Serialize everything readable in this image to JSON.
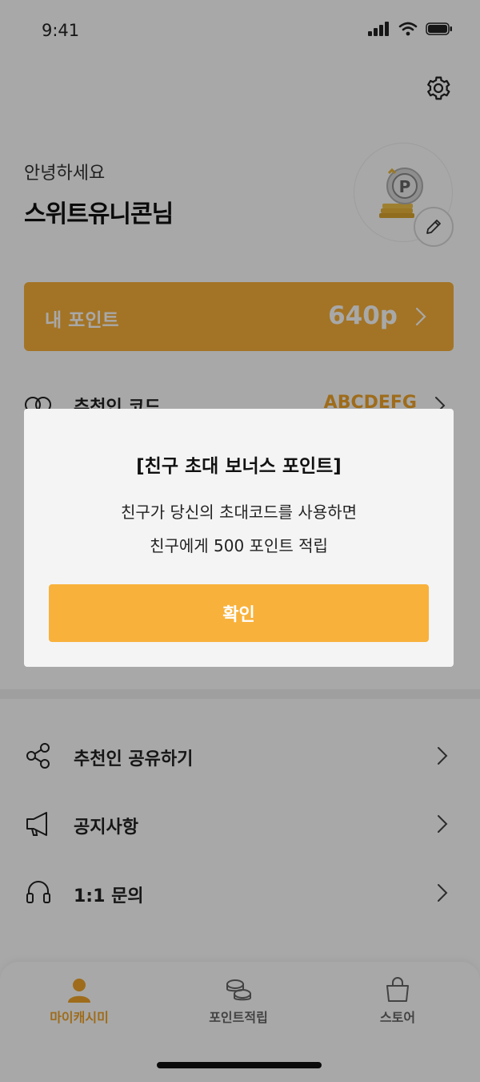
{
  "status": {
    "time": "9:41"
  },
  "header": {
    "settings_icon": "gear-icon"
  },
  "profile": {
    "greeting": "안녕하세요",
    "username": "스위트유니콘님",
    "avatar_icon": "coin-stack-icon",
    "edit_icon": "pencil-icon"
  },
  "points": {
    "label": "내 포인트",
    "value": "640p"
  },
  "referral": {
    "label": "추천인 코드",
    "code": "ABCDEFG"
  },
  "menu": {
    "items": [
      {
        "label": "추천인 공유하기",
        "icon": "share-icon"
      },
      {
        "label": "공지사항",
        "icon": "megaphone-icon"
      },
      {
        "label": "1:1 문의",
        "icon": "headset-icon"
      }
    ]
  },
  "tabs": [
    {
      "label": "마이캐시미",
      "icon": "person-icon",
      "active": true
    },
    {
      "label": "포인트적립",
      "icon": "coins-icon",
      "active": false
    },
    {
      "label": "스토어",
      "icon": "shopping-bag-icon",
      "active": false
    }
  ],
  "dialog": {
    "title": "[친구 초대 보너스 포인트]",
    "line1": "친구가 당신의 초대코드를 사용하면",
    "line2": "친구에게 500 포인트 적립",
    "confirm_label": "확인"
  },
  "colors": {
    "accent": "#f8b13b",
    "accent_text": "#f0a52a",
    "overlay": "rgba(0,0,0,0.34)"
  }
}
